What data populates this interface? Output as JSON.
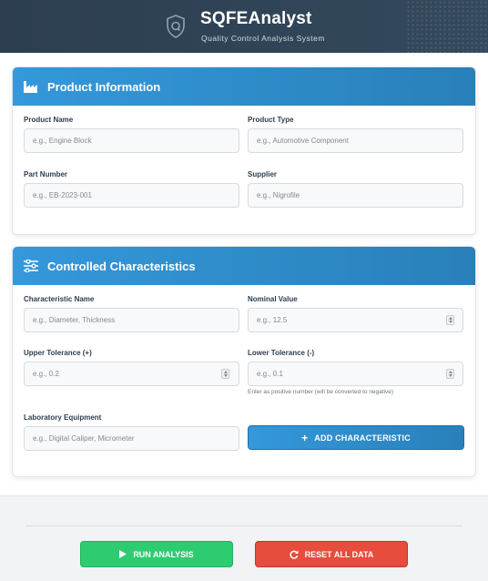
{
  "header": {
    "title": "SQFEAnalyst",
    "subtitle": "Quality Control Analysis System",
    "logo_icon": "shield-q-icon"
  },
  "product_info": {
    "title": "Product Information",
    "icon": "factory-icon",
    "fields": {
      "product_name": {
        "label": "Product Name",
        "placeholder": "e.g., Engine Block",
        "value": ""
      },
      "product_type": {
        "label": "Product Type",
        "placeholder": "e.g., Automotive Component",
        "value": ""
      },
      "part_number": {
        "label": "Part Number",
        "placeholder": "e.g., EB-2023-001",
        "value": ""
      },
      "supplier": {
        "label": "Supplier",
        "placeholder": "e.g., Nigrofile",
        "value": ""
      }
    }
  },
  "characteristics": {
    "title": "Controlled Characteristics",
    "icon": "sliders-icon",
    "fields": {
      "characteristic_name": {
        "label": "Characteristic Name",
        "placeholder": "e.g., Diameter, Thickness",
        "value": ""
      },
      "nominal_value": {
        "label": "Nominal Value",
        "placeholder": "e.g., 12.5",
        "value": ""
      },
      "upper_tolerance": {
        "label": "Upper Tolerance (+)",
        "placeholder": "e.g., 0.2",
        "value": ""
      },
      "lower_tolerance": {
        "label": "Lower Tolerance (-)",
        "placeholder": "e.g., 0.1",
        "value": "",
        "hint": "Enter as positive number (will be converted to negative)"
      },
      "lab_equipment": {
        "label": "Laboratory Equipment",
        "placeholder": "e.g., Digital Caliper, Micrometer",
        "value": ""
      }
    },
    "add_button": {
      "label": "ADD CHARACTERISTIC",
      "icon": "plus-icon"
    }
  },
  "actions": {
    "run": {
      "label": "RUN ANALYSIS",
      "icon": "play-icon",
      "color": "#2ecc71"
    },
    "reset": {
      "label": "RESET ALL DATA",
      "icon": "redo-icon",
      "color": "#e74c3c"
    }
  },
  "colors": {
    "header_bg": "#2c3e50",
    "accent": "#3498db",
    "page_bg": "#f1f3f5"
  }
}
